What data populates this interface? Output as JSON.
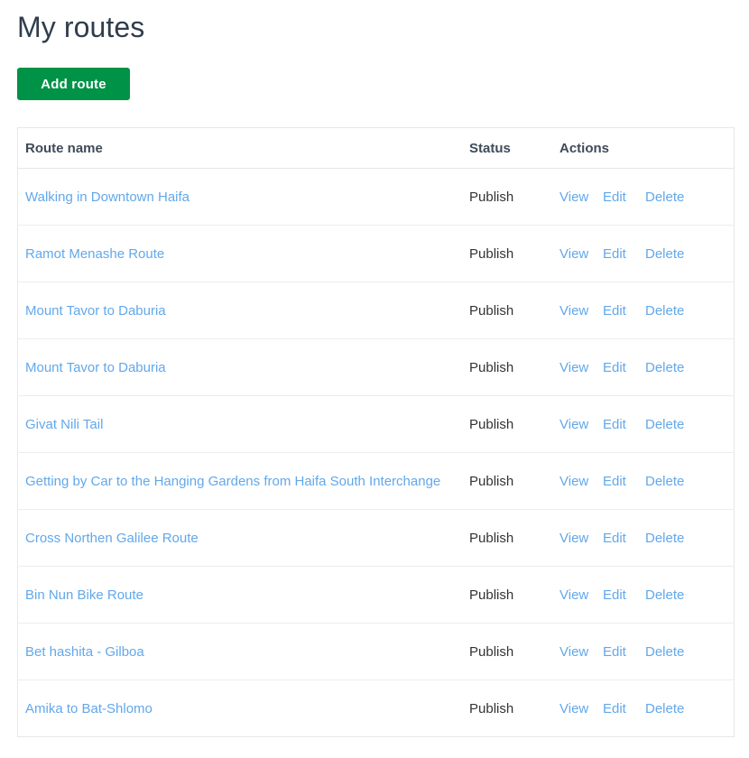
{
  "page": {
    "title": "My routes",
    "add_button_label": "Add route",
    "accent_green": "#009246",
    "link_blue": "#62a8ea",
    "header_text_color": "#3e4b59"
  },
  "table": {
    "columns": [
      "Route name",
      "Status",
      "Actions"
    ],
    "actions": {
      "view": "View",
      "edit": "Edit",
      "delete": "Delete"
    },
    "rows": [
      {
        "name": "Walking in Downtown Haifa",
        "status": "Publish"
      },
      {
        "name": "Ramot Menashe Route",
        "status": "Publish"
      },
      {
        "name": "Mount Tavor to Daburia",
        "status": "Publish"
      },
      {
        "name": "Mount Tavor to Daburia",
        "status": "Publish"
      },
      {
        "name": "Givat Nili Tail",
        "status": "Publish"
      },
      {
        "name": "Getting by Car to the Hanging Gardens from Haifa South Interchange",
        "status": "Publish"
      },
      {
        "name": "Cross Northen Galilee Route",
        "status": "Publish"
      },
      {
        "name": "Bin Nun Bike Route",
        "status": "Publish"
      },
      {
        "name": "Bet hashita - Gilboa",
        "status": "Publish"
      },
      {
        "name": "Amika to Bat-Shlomo",
        "status": "Publish"
      }
    ]
  }
}
